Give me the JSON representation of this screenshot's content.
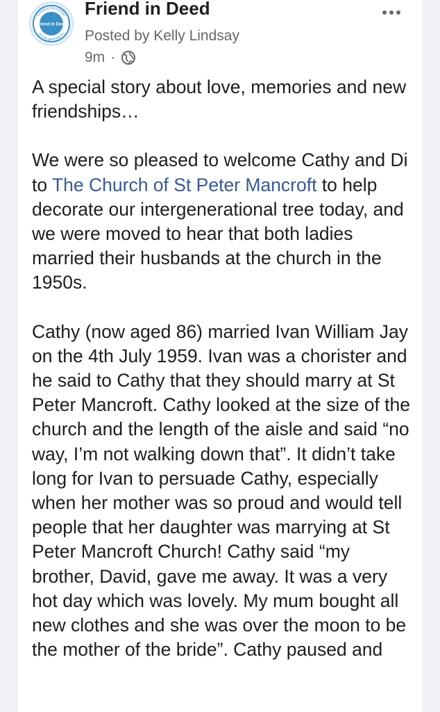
{
  "post": {
    "page_name": "Friend in Deed",
    "posted_by": "Posted by Kelly Lindsay",
    "time": "9m",
    "separator": "·",
    "privacy_icon": "globe-icon",
    "more_icon": "more-options-icon",
    "avatar": {
      "logo_name": "Friend in Deed",
      "ring_text_top": "Creating friendships",
      "ring_text_bottom": "across generations"
    }
  },
  "body": {
    "paragraph1": "A special story about love, memories and new friendships…",
    "paragraph2_before": "We were so pleased to welcome Cathy and Di to ",
    "paragraph2_link": "The Church of St Peter Mancroft",
    "paragraph2_after": " to help decorate our intergenerational tree today, and we were moved to hear that both ladies married their husbands at the church in the 1950s.",
    "paragraph3": "Cathy (now aged 86) married Ivan William Jay on the 4th July 1959. Ivan was a chorister and he said to Cathy that they should marry at St Peter Mancroft. Cathy looked at the size of the church and the length of the aisle and said “no way, I’m not walking down that”. It didn’t take long for Ivan to persuade Cathy, especially when her mother was so proud and would tell people that her daughter was marrying at St Peter Mancroft Church! Cathy said “my brother, David, gave me away. It was a very hot day which was lovely. My mum bought all new clothes and she was over the moon to be the mother of the bride”. Cathy paused and"
  },
  "colors": {
    "link": "#385898",
    "meta_text": "#65676b",
    "logo_blue": "#3a8fc7"
  }
}
